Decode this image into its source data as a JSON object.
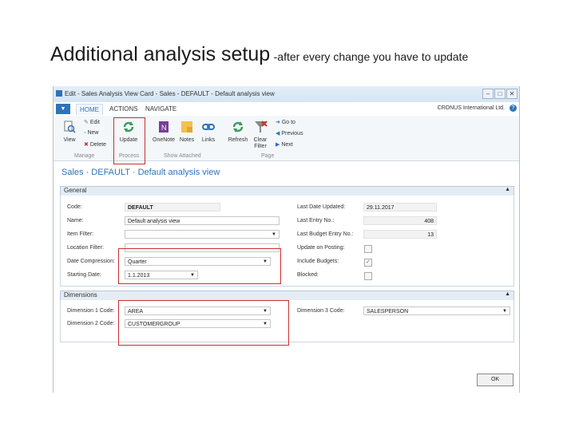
{
  "slide": {
    "title_main": "Additional analysis setup",
    "title_sub": "-after every change you have to update"
  },
  "window": {
    "title": "Edit - Sales Analysis View Card - Sales - DEFAULT - Default analysis view",
    "minimize": "–",
    "maximize": "□",
    "close": "✕"
  },
  "ribbon": {
    "tabs": [
      "HOME",
      "ACTIONS",
      "NAVIGATE"
    ],
    "company": "CRONUS International Ltd.",
    "help": "?",
    "buttons": {
      "view": "View",
      "edit": "Edit",
      "new": "New",
      "delete": "Delete",
      "update": "Update",
      "onenote": "OneNote",
      "notes": "Notes",
      "links": "Links",
      "refresh": "Refresh",
      "clear_filter": "Clear Filter",
      "goto": "Go to",
      "previous": "Previous",
      "next": "Next"
    },
    "groups": {
      "manage": "Manage",
      "process": "Process",
      "show_attached": "Show Attached",
      "page": "Page"
    }
  },
  "page": {
    "title": "Sales · DEFAULT · Default analysis view"
  },
  "general": {
    "header": "General",
    "code_label": "Code:",
    "code_value": "DEFAULT",
    "name_label": "Name:",
    "name_value": "Default analysis view",
    "item_filter_label": "Item Filter:",
    "item_filter_value": "",
    "location_filter_label": "Location Filter:",
    "location_filter_value": "",
    "date_compression_label": "Date Compression:",
    "date_compression_value": "Quarter",
    "starting_date_label": "Starting Date:",
    "starting_date_value": "1.1.2013",
    "last_date_updated_label": "Last Date Updated:",
    "last_date_updated_value": "29.11.2017",
    "last_entry_no_label": "Last Entry No.:",
    "last_entry_no_value": "408",
    "last_budget_entry_no_label": "Last Budget Entry No.:",
    "last_budget_entry_no_value": "13",
    "update_on_posting_label": "Update on Posting:",
    "update_on_posting_checked": false,
    "include_budgets_label": "Include Budgets:",
    "include_budgets_checked": true,
    "blocked_label": "Blocked:",
    "blocked_checked": false,
    "check_mark": "✓"
  },
  "dimensions": {
    "header": "Dimensions",
    "dim1_label": "Dimension 1 Code:",
    "dim1_value": "AREA",
    "dim2_label": "Dimension 2 Code:",
    "dim2_value": "CUSTOMERGROUP",
    "dim3_label": "Dimension 3 Code:",
    "dim3_value": "SALESPERSON"
  },
  "footer": {
    "ok": "OK"
  },
  "colors": {
    "accent": "#2e73b9",
    "highlight_box": "#c9302c"
  }
}
